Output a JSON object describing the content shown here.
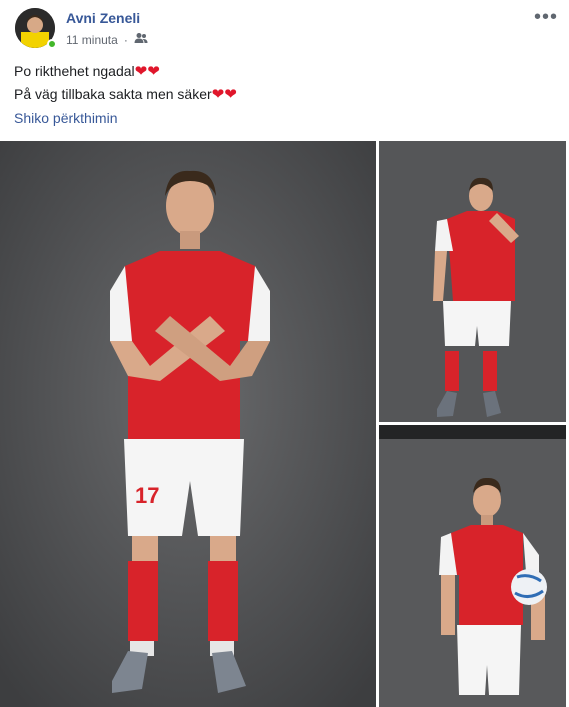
{
  "post": {
    "author": "Avni Zeneli",
    "timestamp": "11 minuta",
    "audience_icon": "friends-icon",
    "text_line_1": "Po rikthehet ngadal",
    "text_line_2": "På väg tillbaka sakta men säker",
    "see_translation": "Shiko përkthimin",
    "more_icon": "more-options-icon",
    "accent": "#385898"
  },
  "photos": {
    "main_alt": "player-photo-main",
    "shirt_number": "17",
    "jersey_color": "#d8232a"
  }
}
